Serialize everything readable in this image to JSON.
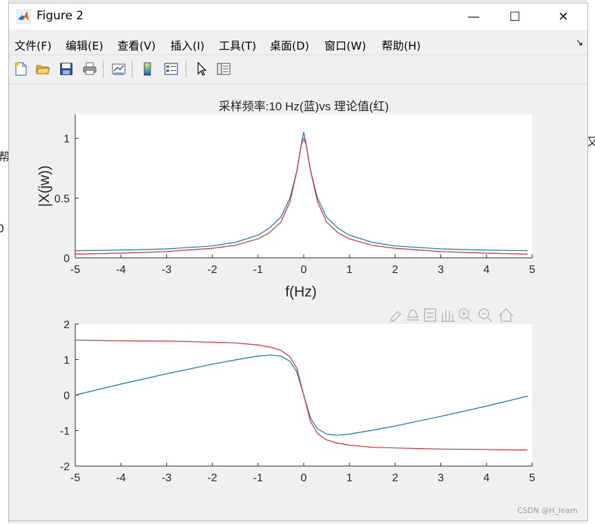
{
  "window": {
    "title": "Figure 2",
    "minimize_glyph": "—",
    "maximize_glyph": "☐",
    "close_glyph": "✕"
  },
  "menubar": {
    "items": [
      "文件(F)",
      "编辑(E)",
      "查看(V)",
      "插入(I)",
      "工具(T)",
      "桌面(D)",
      "窗口(W)",
      "帮助(H)"
    ],
    "overflow_glyph": "↘"
  },
  "toolbar": {
    "icons": [
      "new-figure-icon",
      "open-folder-icon",
      "save-icon",
      "print-icon",
      "link-plot-icon",
      "colorbar-icon",
      "legend-icon",
      "pointer-icon",
      "property-inspector-icon"
    ]
  },
  "axes_toolbar": {
    "icons": [
      "brush-icon",
      "data-tip-icon",
      "datacursor-icon",
      "pan-icon",
      "zoom-in-icon",
      "zoom-out-icon",
      "home-icon"
    ]
  },
  "background_fragments": [
    "帮",
    "0",
    "又"
  ],
  "watermark": "CSDN @H_learn",
  "colors": {
    "blue": "#0072bd",
    "red": "#e0242c"
  },
  "chart_data": [
    {
      "type": "line",
      "title": "采样频率:10 Hz(蓝)vs 理论值(红)",
      "xlabel": "f(Hz)",
      "ylabel": "|X(jw))",
      "xlim": [
        -5,
        5
      ],
      "ylim": [
        0,
        1.2
      ],
      "xticks": [
        "-5",
        "-4",
        "-3",
        "-2",
        "-1",
        "0",
        "1",
        "2",
        "3",
        "4",
        "5"
      ],
      "yticks": [
        "0",
        "0.5",
        "1"
      ],
      "grid": false,
      "series": [
        {
          "color": "#0072bd",
          "x": [
            -5,
            -4,
            -3,
            -2,
            -1.5,
            -1,
            -0.75,
            -0.5,
            -0.3,
            -0.15,
            -0.05,
            0,
            0.05,
            0.15,
            0.3,
            0.5,
            0.75,
            1,
            1.5,
            2,
            3,
            4,
            4.9
          ],
          "y": [
            0.06,
            0.065,
            0.075,
            0.1,
            0.13,
            0.19,
            0.25,
            0.34,
            0.5,
            0.73,
            0.96,
            1.05,
            0.96,
            0.73,
            0.5,
            0.34,
            0.25,
            0.19,
            0.13,
            0.1,
            0.075,
            0.065,
            0.06
          ]
        },
        {
          "color": "#e0242c",
          "x": [
            -5,
            -4,
            -3,
            -2,
            -1.5,
            -1,
            -0.75,
            -0.5,
            -0.3,
            -0.15,
            -0.05,
            0,
            0.05,
            0.15,
            0.3,
            0.5,
            0.75,
            1,
            1.5,
            2,
            3,
            4,
            4.9
          ],
          "y": [
            0.032,
            0.04,
            0.053,
            0.08,
            0.105,
            0.16,
            0.21,
            0.3,
            0.47,
            0.73,
            0.95,
            1.0,
            0.95,
            0.73,
            0.47,
            0.3,
            0.21,
            0.16,
            0.105,
            0.08,
            0.053,
            0.04,
            0.032
          ]
        }
      ]
    },
    {
      "type": "line",
      "title": "",
      "xlabel": "",
      "ylabel": "",
      "xlim": [
        -5,
        5
      ],
      "ylim": [
        -2,
        2
      ],
      "xticks": [
        "-5",
        "-4",
        "-3",
        "-2",
        "-1",
        "0",
        "1",
        "2",
        "3",
        "4",
        "5"
      ],
      "yticks": [
        "-2",
        "-1",
        "0",
        "1",
        "2"
      ],
      "grid": false,
      "series": [
        {
          "color": "#0072bd",
          "x": [
            -5,
            -4,
            -3,
            -2,
            -1.5,
            -1,
            -0.72,
            -0.5,
            -0.3,
            -0.15,
            0,
            0.15,
            0.3,
            0.5,
            0.72,
            1,
            1.5,
            2,
            3,
            4,
            4.9
          ],
          "y": [
            0.0,
            0.31,
            0.6,
            0.87,
            0.99,
            1.1,
            1.13,
            1.1,
            0.95,
            0.65,
            0.0,
            -0.65,
            -0.95,
            -1.1,
            -1.13,
            -1.1,
            -0.99,
            -0.87,
            -0.6,
            -0.31,
            -0.03
          ]
        },
        {
          "color": "#e0242c",
          "x": [
            -5,
            -4,
            -3,
            -2,
            -1.5,
            -1,
            -0.72,
            -0.5,
            -0.3,
            -0.15,
            0,
            0.15,
            0.3,
            0.5,
            0.72,
            1,
            1.5,
            2,
            3,
            4,
            4.9
          ],
          "y": [
            1.55,
            1.53,
            1.52,
            1.49,
            1.47,
            1.41,
            1.35,
            1.26,
            1.08,
            0.75,
            0.0,
            -0.75,
            -1.08,
            -1.26,
            -1.35,
            -1.41,
            -1.47,
            -1.49,
            -1.52,
            -1.53,
            -1.55
          ]
        }
      ]
    }
  ]
}
